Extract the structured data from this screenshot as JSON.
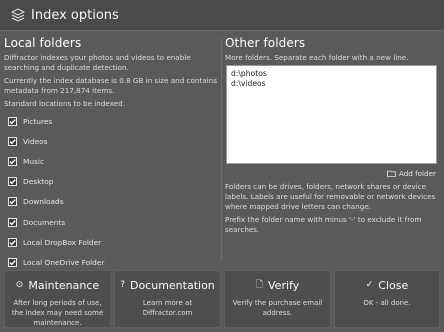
{
  "window": {
    "title": "Index options",
    "title_icon": "layers-icon"
  },
  "local": {
    "heading": "Local folders",
    "desc1": "Diffractor indexes your photos and videos to enable searching and duplicate detection.",
    "desc2": "Currently the index database is 0.8 GB in size and contains metadata from 217,874 items.",
    "desc3": "Standard locations to be indexed.",
    "items": [
      {
        "label": "Pictures",
        "checked": true
      },
      {
        "label": "Videos",
        "checked": true
      },
      {
        "label": "Music",
        "checked": true
      },
      {
        "label": "Desktop",
        "checked": true
      },
      {
        "label": "Downloads",
        "checked": true
      },
      {
        "label": "Documents",
        "checked": true
      },
      {
        "label": "Local DropBox Folder",
        "checked": true
      },
      {
        "label": "Local OneDrive Folder",
        "checked": true
      }
    ]
  },
  "other": {
    "heading": "Other folders",
    "desc": "More folders. Separate each folder with a new line.",
    "folders_value": "d:\\photos\nd:\\videos",
    "add_folder_label": "Add folder",
    "info1": "Folders can be drives, folders, network shares or device labels. Labels are useful for removable or network devices where mapped drive letters can change.",
    "info2": "Prefix the folder name with minus '-' to exclude it from searches."
  },
  "buttons": [
    {
      "title": "Maintenance",
      "icon": "⊙",
      "desc": "After long periods of use, the index may need some maintenance."
    },
    {
      "title": "Documentation",
      "icon": "?",
      "desc": "Learn more at Diffractor.com"
    },
    {
      "title": "Verify",
      "icon": "🗋",
      "desc": "Verify the purchase email address."
    },
    {
      "title": "Close",
      "icon": "✓",
      "desc": "OK - all done."
    }
  ],
  "colors": {
    "background": "#5a5a5a",
    "titlebar": "#4a4a4a",
    "button": "#4e4e4e",
    "textbox": "#ffffff"
  }
}
